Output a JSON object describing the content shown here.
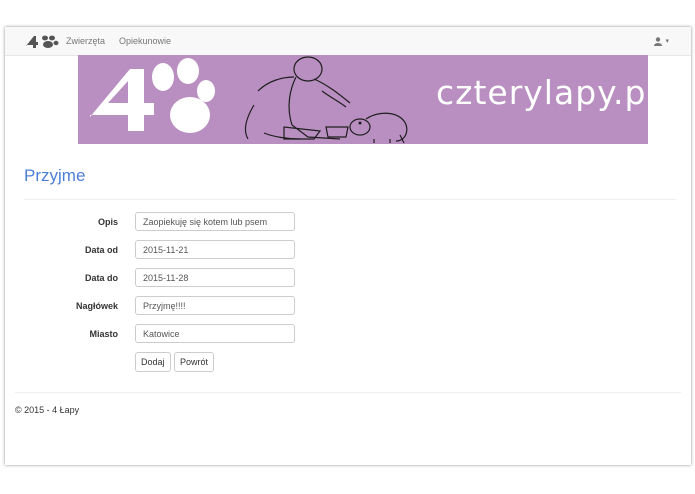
{
  "navbar": {
    "links": [
      {
        "label": "Zwierzęta"
      },
      {
        "label": "Opiekunowie"
      }
    ],
    "user_caret": "▾"
  },
  "banner": {
    "site_name": "czterylapy.pl",
    "background": "#b98fc1"
  },
  "page": {
    "title": "Przyjme"
  },
  "form": {
    "fields": [
      {
        "label": "Opis",
        "value": "Zaopiekuję się kotem lub psem"
      },
      {
        "label": "Data od",
        "value": "2015-11-21"
      },
      {
        "label": "Data do",
        "value": "2015-11-28"
      },
      {
        "label": "Nagłówek",
        "value": "Przyjmę!!!!"
      },
      {
        "label": "Miasto",
        "value": "Katowice"
      }
    ],
    "submit_label": "Dodaj",
    "back_label": "Powrót"
  },
  "footer": {
    "text": "© 2015 - 4 Łapy"
  },
  "colors": {
    "title": "#4c7fd6",
    "navbar": "#f8f8f8"
  }
}
